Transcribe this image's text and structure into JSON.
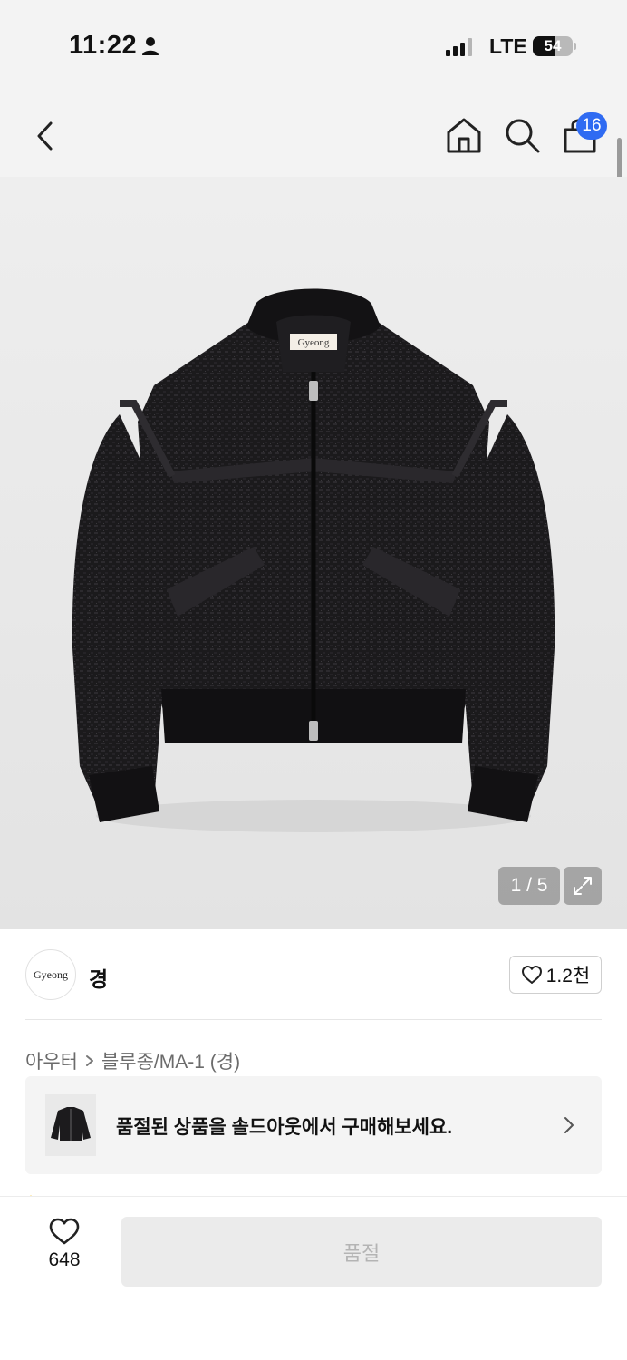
{
  "status_bar": {
    "time": "11:22",
    "network": "LTE",
    "battery": "54"
  },
  "header": {
    "cart_count": "16",
    "icons": [
      "back-icon",
      "home-icon",
      "search-icon",
      "cart-icon"
    ]
  },
  "gallery": {
    "page_indicator": "1 / 5",
    "label_text": "Gyeong",
    "expand_icon": "expand-icon"
  },
  "brand": {
    "logo_text": "Gyeong",
    "name": "경",
    "likes": "1.2천"
  },
  "breadcrumb": {
    "category": "아우터",
    "subcategory": "블루종/MA-1 (경)"
  },
  "soldout_banner": {
    "text": "품절된 상품을 솔드아웃에서 구매해보세요."
  },
  "bottom_bar": {
    "wish_count": "648",
    "buy_label": "품절"
  },
  "colors": {
    "accent": "#2f6bf2",
    "header_bg": "#f3f3f3",
    "disabled_button": "#ebebeb"
  }
}
